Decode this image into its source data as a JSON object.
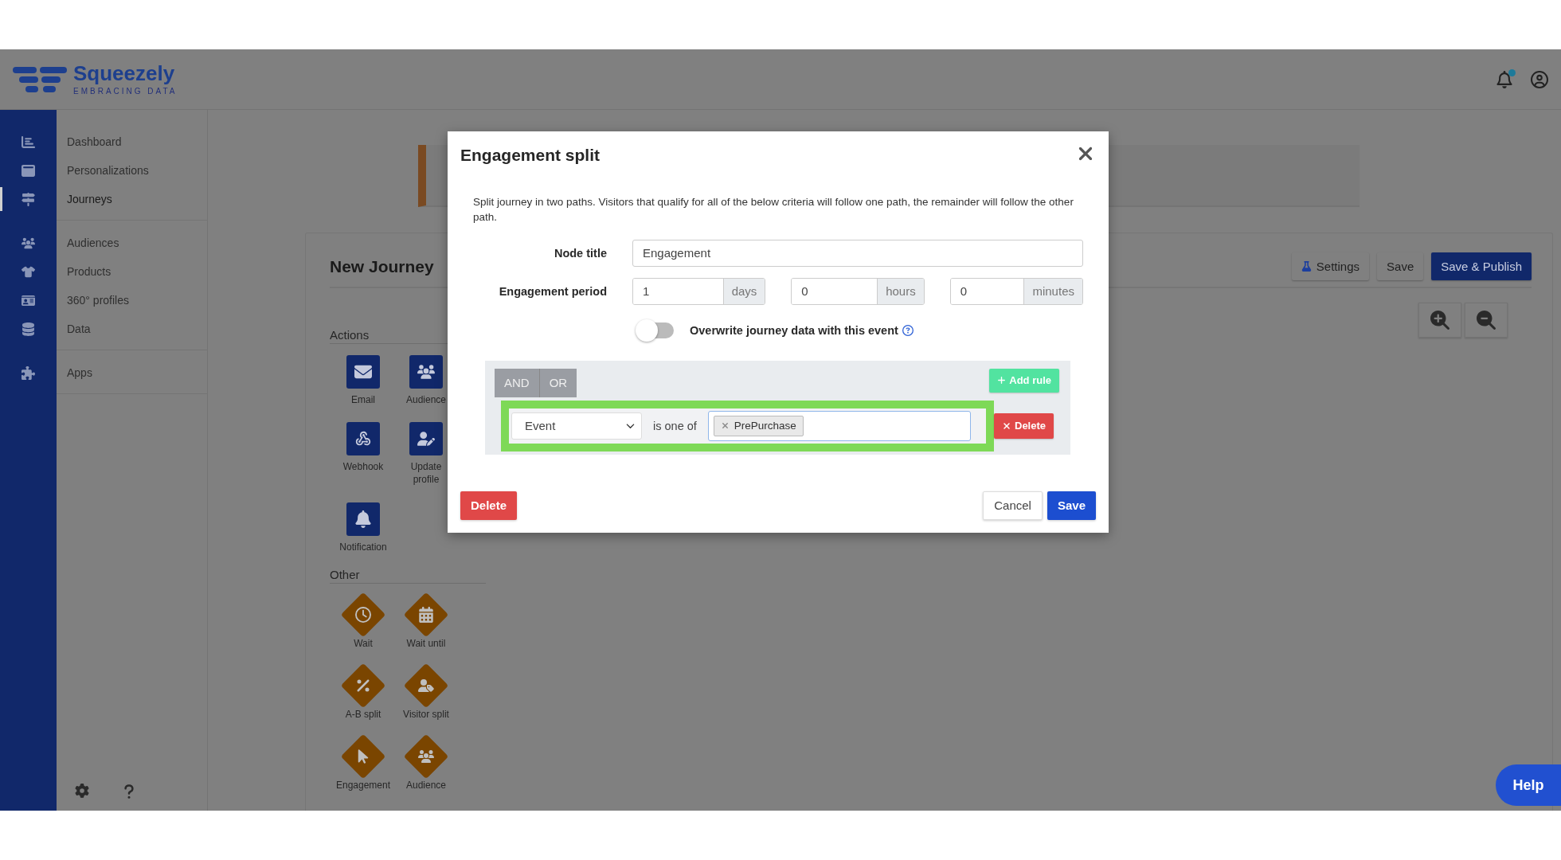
{
  "header": {
    "logo": {
      "name": "Squeezely",
      "tagline": "EMBRACING DATA"
    }
  },
  "sidebar": {
    "groups": [
      {
        "items": [
          {
            "label": "Dashboard",
            "selected": false
          },
          {
            "label": "Personalizations",
            "selected": false
          },
          {
            "label": "Journeys",
            "selected": true
          }
        ]
      },
      {
        "items": [
          {
            "label": "Audiences",
            "selected": false
          },
          {
            "label": "Products",
            "selected": false
          },
          {
            "label": "360° profiles",
            "selected": false
          },
          {
            "label": "Data",
            "selected": false
          }
        ]
      },
      {
        "items": [
          {
            "label": "Apps",
            "selected": false
          }
        ]
      }
    ]
  },
  "page": {
    "title": "New Journey",
    "buttons": [
      {
        "label": "Settings",
        "kind": "settings"
      },
      {
        "label": "Save",
        "kind": "plain"
      },
      {
        "label": "Save & Publish",
        "kind": "primary"
      }
    ],
    "palette": [
      {
        "heading": "Actions",
        "kind": "action",
        "tiles": [
          {
            "label": "Email"
          },
          {
            "label": "Audience"
          },
          {
            "label": "Webhook"
          },
          {
            "label": "Update profile"
          },
          {
            "label": "Notification"
          }
        ]
      },
      {
        "heading": "Other",
        "kind": "other",
        "tiles": [
          {
            "label": "Wait"
          },
          {
            "label": "Wait until"
          },
          {
            "label": "A-B split"
          },
          {
            "label": "Visitor split"
          },
          {
            "label": "Engagement"
          },
          {
            "label": "Audience"
          }
        ]
      }
    ]
  },
  "dialog": {
    "title": "Engagement split",
    "description": "Split journey in two paths. Visitors that qualify for all of the below criteria will follow one path, the remainder will follow the other path.",
    "node_title": {
      "label": "Node title",
      "value": "Engagement"
    },
    "engagement_period": {
      "label": "Engagement period",
      "fields": [
        {
          "value": "1",
          "unit": "days"
        },
        {
          "value": "0",
          "unit": "hours"
        },
        {
          "value": "0",
          "unit": "minutes"
        }
      ]
    },
    "overwrite": {
      "label": "Overwrite journey data with this event",
      "on": false
    },
    "rules": {
      "operators": [
        "AND",
        "OR"
      ],
      "add_label": "Add rule",
      "rows": [
        {
          "field": "Event",
          "operator": "is one of",
          "tags": [
            "PrePurchase"
          ],
          "delete_label": "Delete"
        }
      ]
    },
    "footer": {
      "delete": "Delete",
      "cancel": "Cancel",
      "save": "Save"
    }
  },
  "help": "Help"
}
